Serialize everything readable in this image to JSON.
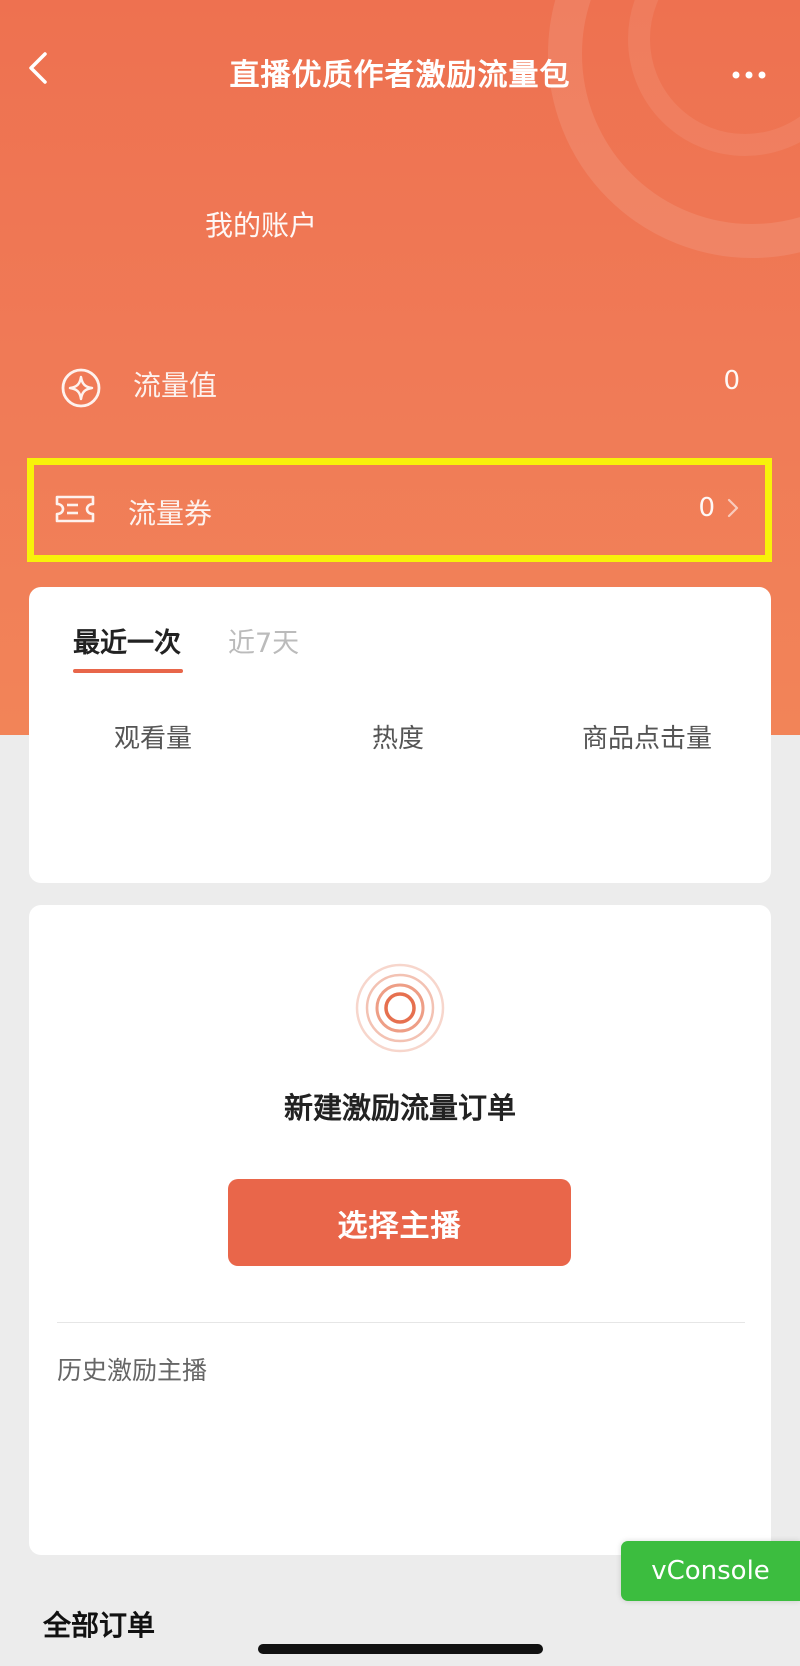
{
  "header": {
    "title": "直播优质作者激励流量包"
  },
  "account": {
    "label": "我的账户",
    "rows": [
      {
        "label": "流量值",
        "value": "0",
        "icon": "sparkle-circle-icon"
      },
      {
        "label": "流量券",
        "value": "0",
        "icon": "ticket-icon"
      }
    ]
  },
  "stats_card": {
    "tabs": [
      {
        "label": "最近一次",
        "active": true
      },
      {
        "label": "近7天",
        "active": false
      }
    ],
    "metrics": [
      {
        "label": "观看量"
      },
      {
        "label": "热度"
      },
      {
        "label": "商品点击量"
      }
    ]
  },
  "new_order_card": {
    "title": "新建激励流量订单",
    "button_label": "选择主播",
    "history_label": "历史激励主播"
  },
  "footer": {
    "all_orders_label": "全部订单"
  },
  "vconsole": {
    "label": "vConsole"
  },
  "colors": {
    "brand": "#ee7150",
    "button": "#e9664a",
    "highlight_border": "#f8f20a",
    "vconsole": "#3cbd3f"
  },
  "icons": {
    "back": "back-arrow-icon",
    "more": "more-dots-icon",
    "chevron": "chevron-right-icon",
    "radio": "radio-waves-icon"
  }
}
